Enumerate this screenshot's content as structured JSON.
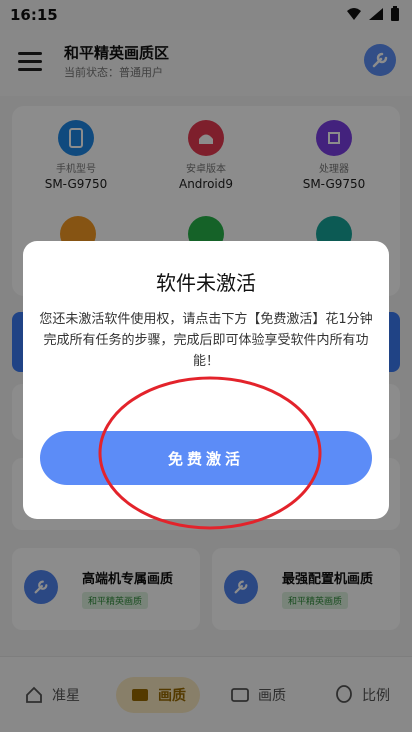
{
  "status_bar": {
    "time": "16:15"
  },
  "header": {
    "title": "和平精英画质区",
    "subtitle": "当前状态：普通用户"
  },
  "device_info": [
    {
      "label": "手机型号",
      "value": "SM-G9750",
      "icon": "phone-icon",
      "color": "#1e88e5"
    },
    {
      "label": "安卓版本",
      "value": "Android9",
      "icon": "android-icon",
      "color": "#e53950"
    },
    {
      "label": "处理器",
      "value": "SM-G9750",
      "icon": "cpu-icon",
      "color": "#7b3fe4"
    }
  ],
  "quality_cards": [
    {
      "title": "高端机专属画质",
      "tag": "和平精英画质"
    },
    {
      "title": "最强配置机画质",
      "tag": "和平精英画质"
    }
  ],
  "bottom_nav": [
    {
      "label": "准星",
      "icon": "home-icon"
    },
    {
      "label": "画质",
      "icon": "quality-icon",
      "active": true
    },
    {
      "label": "画质",
      "icon": "folder-icon"
    },
    {
      "label": "比例",
      "icon": "alien-icon"
    }
  ],
  "dialog": {
    "title": "软件未激活",
    "message": "您还未激活软件使用权，请点击下方【免费激活】花1分钟完成所有任务的步骤，完成后即可体验享受软件内所有功能！",
    "button_label": "免费激活"
  },
  "colors": {
    "accent": "#5c8cf7",
    "annotation": "#e3232b",
    "overlay": "rgba(0,0,0,0.45)"
  }
}
